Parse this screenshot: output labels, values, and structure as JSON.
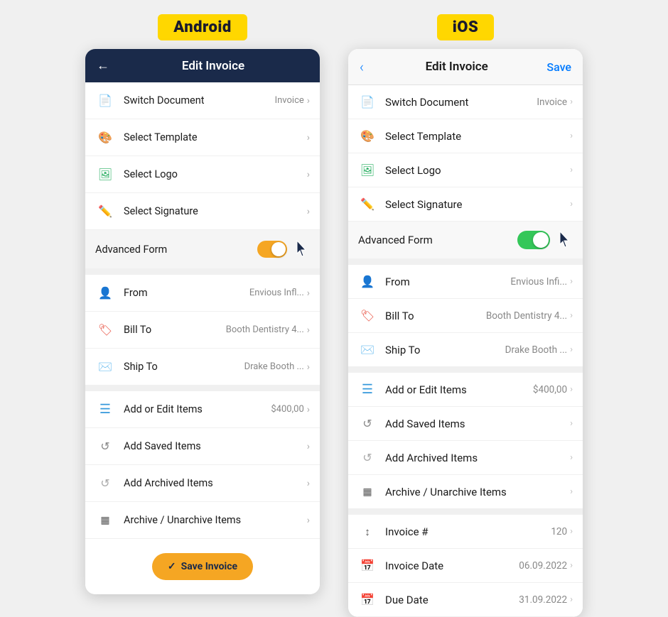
{
  "android": {
    "badge": "Android",
    "header": {
      "title": "Edit Invoice",
      "back_icon": "←"
    },
    "items": [
      {
        "icon": "📄",
        "icon_color": "#555",
        "label": "Switch Document",
        "value": "Invoice",
        "has_chevron": true
      },
      {
        "icon": "🎨",
        "icon_color": "#9B59B6",
        "label": "Select Template",
        "value": "",
        "has_chevron": true
      },
      {
        "icon": "🖼",
        "icon_color": "#27AE60",
        "label": "Select Logo",
        "value": "",
        "has_chevron": true
      },
      {
        "icon": "✏️",
        "icon_color": "#555",
        "label": "Select Signature",
        "value": "",
        "has_chevron": true
      }
    ],
    "advanced_form_label": "Advanced Form",
    "bottom_items": [
      {
        "icon": "👤",
        "icon_color": "#3498DB",
        "label": "From",
        "value": "Envious Infl...",
        "has_chevron": true
      },
      {
        "icon": "🏷",
        "icon_color": "#E74C3C",
        "label": "Bill To",
        "value": "Booth Dentistry 4...",
        "has_chevron": true
      },
      {
        "icon": "✉️",
        "icon_color": "#888",
        "label": "Ship To",
        "value": "Drake Booth ...",
        "has_chevron": true
      }
    ],
    "action_items": [
      {
        "icon": "≡",
        "icon_color": "#3498DB",
        "label": "Add or Edit Items",
        "value": "$400,00",
        "has_chevron": true
      },
      {
        "icon": "↩",
        "icon_color": "#888",
        "label": "Add Saved Items",
        "value": "",
        "has_chevron": true
      },
      {
        "icon": "↩",
        "icon_color": "#aaa",
        "label": "Add Archived Items",
        "value": "",
        "has_chevron": true
      },
      {
        "icon": "▦",
        "icon_color": "#555",
        "label": "Archive / Unarchive Items",
        "value": "",
        "has_chevron": true
      }
    ],
    "save_button": "Save Invoice",
    "save_check": "✓"
  },
  "ios": {
    "badge": "iOS",
    "header": {
      "title": "Edit Invoice",
      "back_icon": "‹",
      "save_label": "Save"
    },
    "items": [
      {
        "icon": "📄",
        "icon_color": "#555",
        "label": "Switch Document",
        "value": "Invoice",
        "has_chevron": true
      },
      {
        "icon": "🎨",
        "icon_color": "#9B59B6",
        "label": "Select Template",
        "value": "",
        "has_chevron": true
      },
      {
        "icon": "🖼",
        "icon_color": "#27AE60",
        "label": "Select Logo",
        "value": "",
        "has_chevron": true
      },
      {
        "icon": "✏️",
        "icon_color": "#555",
        "label": "Select Signature",
        "value": "",
        "has_chevron": true
      }
    ],
    "advanced_form_label": "Advanced Form",
    "bottom_items": [
      {
        "icon": "👤",
        "icon_color": "#3498DB",
        "label": "From",
        "value": "Envious Infi...",
        "has_chevron": true
      },
      {
        "icon": "🏷",
        "icon_color": "#E74C3C",
        "label": "Bill To",
        "value": "Booth Dentistry 4...",
        "has_chevron": true
      },
      {
        "icon": "✉️",
        "icon_color": "#888",
        "label": "Ship To",
        "value": "Drake Booth ...",
        "has_chevron": true
      }
    ],
    "action_items": [
      {
        "icon": "≡",
        "icon_color": "#3498DB",
        "label": "Add or Edit Items",
        "value": "$400,00",
        "has_chevron": true
      },
      {
        "icon": "↩",
        "icon_color": "#888",
        "label": "Add Saved Items",
        "value": "",
        "has_chevron": true
      },
      {
        "icon": "↩",
        "icon_color": "#aaa",
        "label": "Add Archived Items",
        "value": "",
        "has_chevron": true
      },
      {
        "icon": "▦",
        "icon_color": "#555",
        "label": "Archive / Unarchive Items",
        "value": "",
        "has_chevron": true
      }
    ],
    "invoice_items": [
      {
        "icon": "↕",
        "icon_color": "#555",
        "label": "Invoice #",
        "value": "120",
        "has_chevron": true
      },
      {
        "icon": "📅",
        "icon_color": "#E67E22",
        "label": "Invoice Date",
        "value": "06.09.2022",
        "has_chevron": true
      },
      {
        "icon": "📅",
        "icon_color": "#E74C3C",
        "label": "Due Date",
        "value": "31.09.2022",
        "has_chevron": true
      }
    ]
  }
}
